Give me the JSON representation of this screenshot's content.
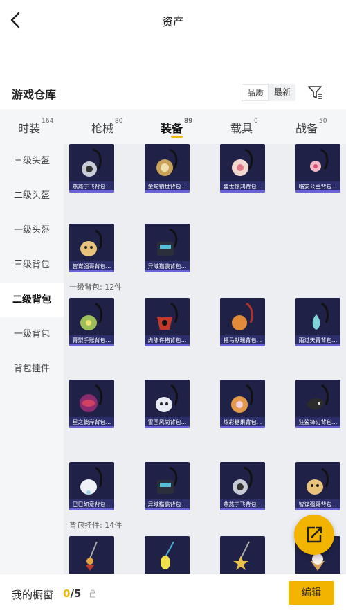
{
  "nav": {
    "title": "资产"
  },
  "warehouse": {
    "title": "游戏仓库",
    "sort_options": [
      "品质",
      "最新"
    ]
  },
  "tabs": [
    {
      "label": "时装",
      "count": "164"
    },
    {
      "label": "枪械",
      "count": "80"
    },
    {
      "label": "装备",
      "count": "89"
    },
    {
      "label": "载具",
      "count": "0"
    },
    {
      "label": "战备",
      "count": "50"
    }
  ],
  "sidebar": {
    "items": [
      {
        "label": "三级头盔"
      },
      {
        "label": "二级头盔"
      },
      {
        "label": "一级头盔"
      },
      {
        "label": "三级背包"
      },
      {
        "label": "二级背包"
      },
      {
        "label": "一级背包"
      },
      {
        "label": "背包挂件"
      }
    ]
  },
  "sections": {
    "level1_bags": "一级背包: 12件",
    "bag_charms": "背包挂件: 14件"
  },
  "items": {
    "row0": [
      "燕燕于飞背包...",
      "金蛇镇世背包...",
      "盛世惊鸿背包...",
      "临安公主背包..."
    ],
    "row1": [
      "智谋强哥背包...",
      "异域猫装背包..."
    ],
    "row2": [
      "青梨手账背包...",
      "虎啸许褚背包...",
      "福马献瑞背包...",
      "雨过天青背包..."
    ],
    "row3": [
      "星之彼岸背包...",
      "雪国风尚背包...",
      "炫彩糖果背包...",
      "狂鲨锋刃背包..."
    ],
    "row4": [
      "巳巳如意背包...",
      "异域猫装背包...",
      "燕燕于飞背包...",
      "智谋强哥背包..."
    ]
  },
  "colors": {
    "accent": "#f3b400",
    "card_bg": "#1f2246",
    "card_label_bg": "#2b2e6b"
  },
  "bottom": {
    "label": "我的橱窗",
    "count_current": "0",
    "count_total": "/5",
    "edit_label": "编辑"
  }
}
